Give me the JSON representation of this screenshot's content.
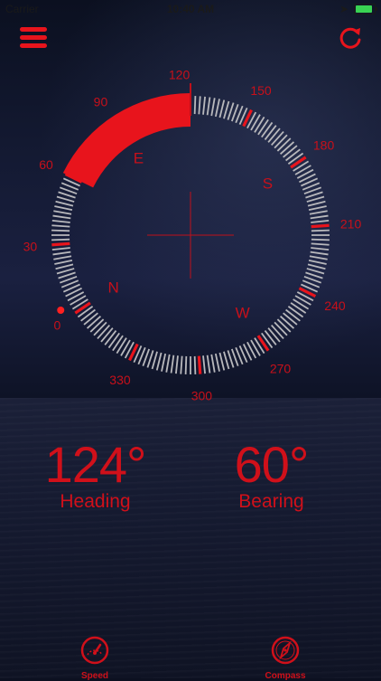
{
  "status_bar": {
    "carrier": "Carrier",
    "time": "10:40 AM"
  },
  "colors": {
    "accent": "#e8141c",
    "tick": "#b8b8bc",
    "background": "#141a33"
  },
  "compass": {
    "degree_labels": [
      "0",
      "30",
      "60",
      "90",
      "120",
      "150",
      "180",
      "210",
      "240",
      "270",
      "300",
      "330"
    ],
    "cardinals": [
      "N",
      "E",
      "S",
      "W"
    ],
    "heading_deg": 124,
    "bearing_deg": 60
  },
  "readouts": {
    "heading": {
      "value": "124°",
      "label": "Heading"
    },
    "bearing": {
      "value": "60°",
      "label": "Bearing"
    }
  },
  "tabs": [
    {
      "label": "Speed",
      "icon": "speedometer-icon"
    },
    {
      "label": "Compass",
      "icon": "compass-icon"
    }
  ],
  "toolbar": {
    "menu_icon": "hamburger-menu-icon",
    "refresh_icon": "refresh-icon"
  }
}
